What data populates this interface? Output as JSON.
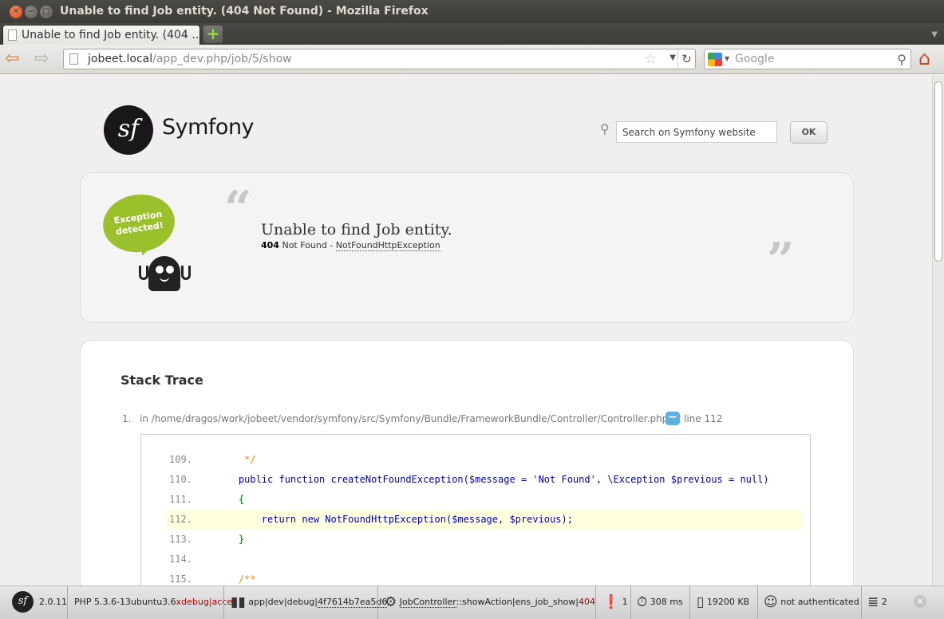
{
  "window": {
    "title": "Unable to find Job entity. (404 Not Found) - Mozilla Firefox"
  },
  "tabs": [
    {
      "label": "Unable to find Job entity. (404 …"
    }
  ],
  "navbar": {
    "url_host": "jobeet.local",
    "url_path": "/app_dev.php/job/5/show",
    "search_placeholder": "Google"
  },
  "symfony": {
    "brand": "Symfony",
    "search_placeholder": "Search on Symfony website",
    "ok_label": "OK"
  },
  "exception": {
    "bubble_text": "Exception detected!",
    "title": "Unable to find Job entity.",
    "code": "404",
    "status": "Not Found",
    "separator": " - ",
    "class": "NotFoundHttpException"
  },
  "trace": {
    "heading": "Stack Trace",
    "items": [
      {
        "num": "1.",
        "text": "in /home/dragos/work/jobeet/vendor/symfony/src/Symfony/Bundle/FrameworkBundle/Controller/Controller.php at line 112"
      }
    ],
    "toggle": "−",
    "lines": [
      {
        "no": "109.",
        "code": "     */"
      },
      {
        "no": "110.",
        "code": "    public function createNotFoundException($message = 'Not Found', \\Exception $previous = null)"
      },
      {
        "no": "111.",
        "code": "    {"
      },
      {
        "no": "112.",
        "code": "        return new NotFoundHttpException($message, $previous);"
      },
      {
        "no": "113.",
        "code": "    }"
      },
      {
        "no": "114.",
        "code": ""
      },
      {
        "no": "115.",
        "code": "    /**"
      }
    ]
  },
  "toolbar": {
    "version": "2.0.11",
    "php": "PHP 5.3.6-13ubuntu3.6",
    "php_ext": "xdebug|accel",
    "env": "app|dev|debug|",
    "token": "4f7614b7ea5d6",
    "controller": "JobController",
    "action": "::showAction|ens_job_show|",
    "status": "404",
    "logs": "1",
    "time": "308 ms",
    "memory": "19200 KB",
    "auth": "not authenticated",
    "queries": "2"
  }
}
